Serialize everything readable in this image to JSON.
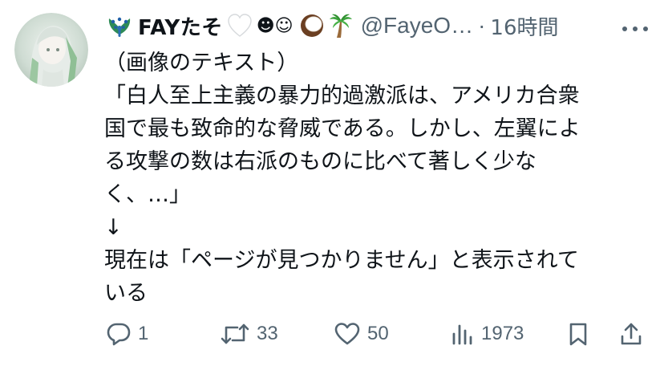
{
  "tweet": {
    "display_name": "FAYたそ",
    "name_emojis": {
      "prefix": "peacock-emoji",
      "heart": "white-heart-emoji",
      "smileys": "☻☺",
      "coconut": "coconut-emoji",
      "palm": "palm-tree-emoji"
    },
    "handle": "@FayeO…",
    "separator": "·",
    "time": "16時間",
    "body_lines": [
      "（画像のテキスト）",
      "「白人至上主義の暴力的過激派は、アメリカ合衆",
      "国で最も致命的な脅威である。しかし、左翼によ",
      "る攻撃の数は右派のものに比べて著しく少な",
      "く、…」",
      "↓",
      "現在は「ページが見つかりません」と表示されて",
      "いる"
    ],
    "metrics": {
      "replies": "1",
      "reposts": "33",
      "likes": "50",
      "views": "1973"
    }
  },
  "icons": {
    "more": "more-dots-icon",
    "reply": "reply-icon",
    "repost": "repost-icon",
    "like": "heart-icon",
    "views": "views-icon",
    "bookmark": "bookmark-icon",
    "share": "share-icon"
  },
  "colors": {
    "text": "#0f1419",
    "secondary": "#536471"
  }
}
